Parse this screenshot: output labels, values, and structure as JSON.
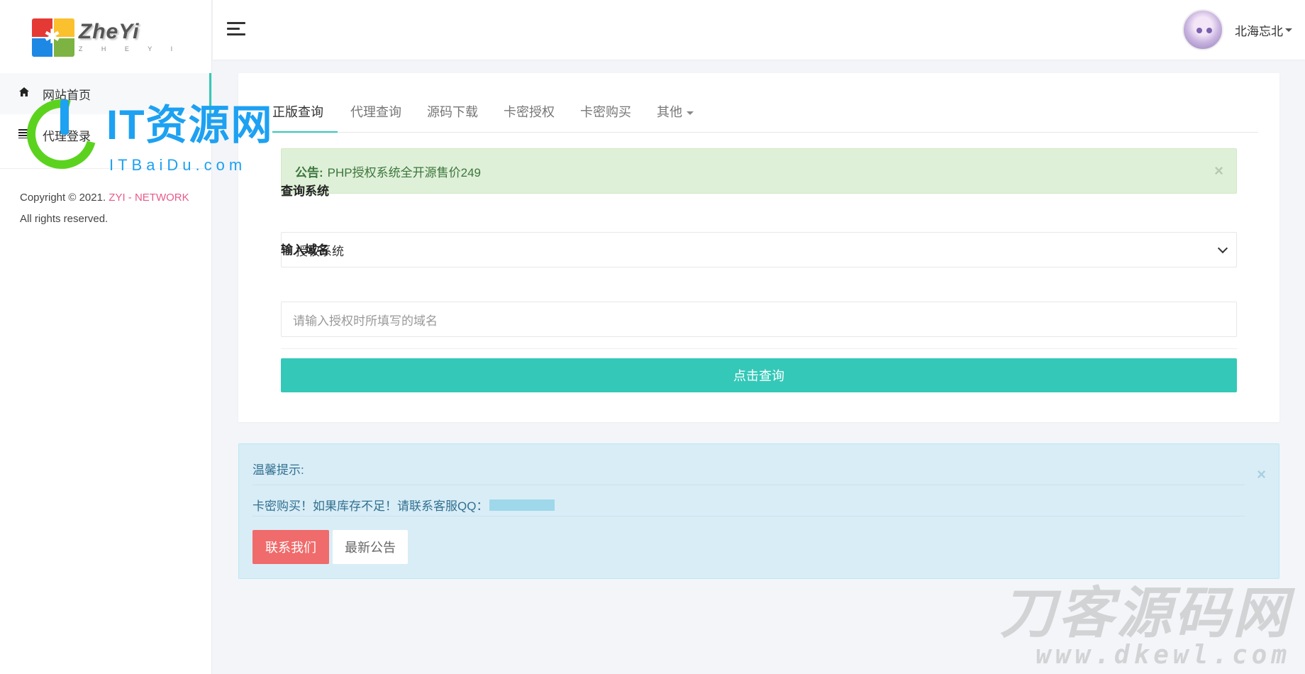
{
  "brand": {
    "name": "ZheYi",
    "subtitle": "Z H E Y I"
  },
  "sidebar": {
    "items": [
      {
        "label": "网站首页",
        "icon": "home-icon"
      },
      {
        "label": "代理登录",
        "icon": "list-icon"
      }
    ],
    "copyright_prefix": "Copyright © 2021. ",
    "copyright_link": "ZYI - NETWORK",
    "copyright_suffix": " All rights reserved."
  },
  "header": {
    "username": "北海忘北"
  },
  "tabs": [
    {
      "label": "正版查询"
    },
    {
      "label": "代理查询"
    },
    {
      "label": "源码下载"
    },
    {
      "label": "卡密授权"
    },
    {
      "label": "卡密购买"
    },
    {
      "label": "其他"
    }
  ],
  "notice": {
    "label": "公告:",
    "text": "PHP授权系统全开源售价249",
    "close": "×"
  },
  "form": {
    "system_label": "查询系统",
    "system_value": "授权系统",
    "domain_label": "输入域名",
    "domain_placeholder": "请输入授权时所填写的域名",
    "submit": "点击查询"
  },
  "tip": {
    "title": "温馨提示:",
    "text": "卡密购买！如果库存不足！请联系客服QQ：",
    "close": "×",
    "contact_button": "联系我们",
    "news_button": "最新公告"
  },
  "watermarks": {
    "top_left_main": "IT资源网",
    "top_left_sub": "ITBaiDu.com",
    "bottom_right_main": "刀客源码网",
    "bottom_right_sub": "www.dkewl.com"
  },
  "colors": {
    "accent": "#34c8b8",
    "danger": "#f06b6b",
    "link_pink": "#e85a8b"
  }
}
